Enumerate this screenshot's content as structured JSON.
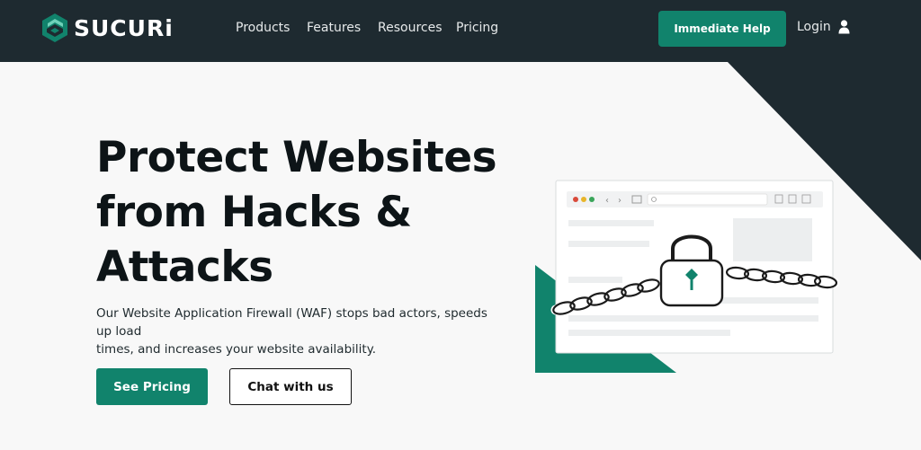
{
  "brand": {
    "name": "SUCURi",
    "accent": "#11836c",
    "dark": "#1e2a30"
  },
  "nav": {
    "items": [
      {
        "label": "Products"
      },
      {
        "label": "Features"
      },
      {
        "label": "Resources"
      },
      {
        "label": "Pricing"
      }
    ],
    "help_label": "Immediate Help",
    "login_label": "Login"
  },
  "hero": {
    "headline_lines": [
      "Protect Websites",
      "from Hacks &",
      "Attacks"
    ],
    "subtext_lines": [
      "Our Website Application Firewall (WAF) stops bad actors, speeds up load",
      "times, and increases your website availability."
    ],
    "primary_cta": "See Pricing",
    "secondary_cta": "Chat with us"
  },
  "icons": {
    "logo": "sucuri-logo-icon",
    "user": "user-icon",
    "lock": "padlock-icon",
    "chain": "chain-icon",
    "browser": "browser-window-illustration"
  }
}
